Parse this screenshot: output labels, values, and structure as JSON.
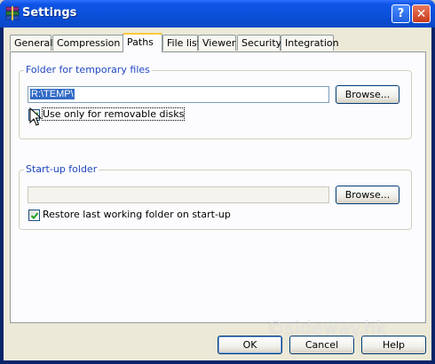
{
  "window": {
    "title": "Settings",
    "help_glyph": "?",
    "close_glyph": "✕"
  },
  "tabs": [
    {
      "label": "General"
    },
    {
      "label": "Compression"
    },
    {
      "label": "Paths",
      "active": true
    },
    {
      "label": "File list"
    },
    {
      "label": "Viewer"
    },
    {
      "label": "Security"
    },
    {
      "label": "Integration"
    }
  ],
  "temp_group": {
    "title": "Folder for temporary files",
    "path_value": "R:\\TEMP\\",
    "browse_label": "Browse...",
    "removable_label": "Use only for removable disks",
    "removable_checked": true
  },
  "startup_group": {
    "title": "Start-up folder",
    "path_value": "",
    "browse_label": "Browse...",
    "restore_label": "Restore last working folder on start-up",
    "restore_checked": true
  },
  "footer": {
    "ok_label": "OK",
    "cancel_label": "Cancel",
    "help_label": "Help"
  },
  "watermark": "©sideway.hk",
  "colors": {
    "title_bar": "#0a4fd8",
    "group_label": "#1f46c0",
    "selection": "#316ac5"
  }
}
